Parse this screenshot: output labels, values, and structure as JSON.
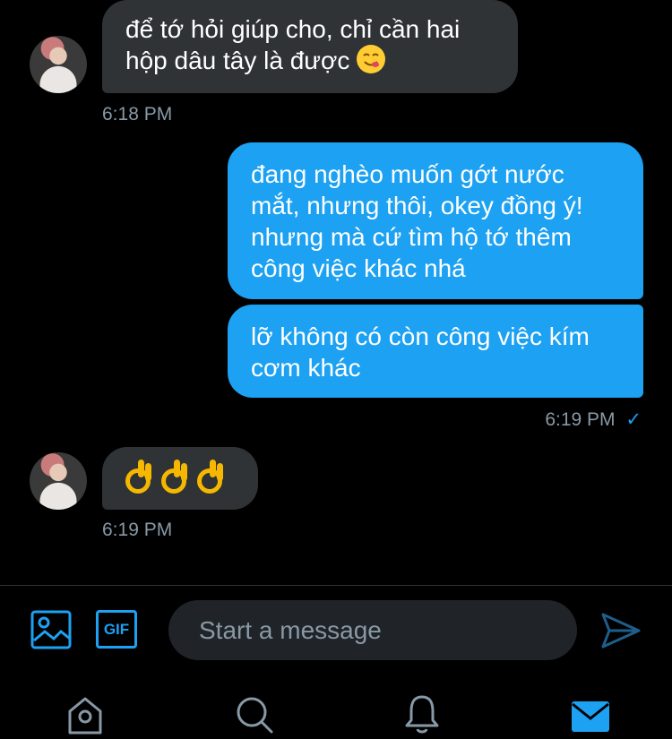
{
  "messages": [
    {
      "text_line1": "để tớ hỏi giúp cho, chỉ cần hai",
      "text_line2": "hộp dâu tây là được",
      "time": "6:18 PM"
    },
    {
      "lines": [
        "đang nghèo muốn gớt nước",
        "mắt, nhưng thôi, okey đồng ý!",
        "nhưng mà cứ tìm hộ tớ thêm",
        "công việc khác nhá"
      ]
    },
    {
      "lines": [
        "lỡ không có còn công việc kím",
        "cơm khác"
      ],
      "time": "6:19 PM",
      "status": "✓"
    },
    {
      "time": "6:19 PM"
    }
  ],
  "composer": {
    "placeholder": "Start a message",
    "gif_label": "GIF"
  },
  "icons": {
    "media": "image-icon",
    "gif": "gif-icon",
    "send": "send-icon",
    "home": "home-icon",
    "search": "search-icon",
    "notifications": "bell-icon",
    "messages": "mail-icon"
  },
  "colors": {
    "accent": "#1da1f2",
    "incoming_bubble": "#2f3336",
    "muted": "#8899a6"
  }
}
